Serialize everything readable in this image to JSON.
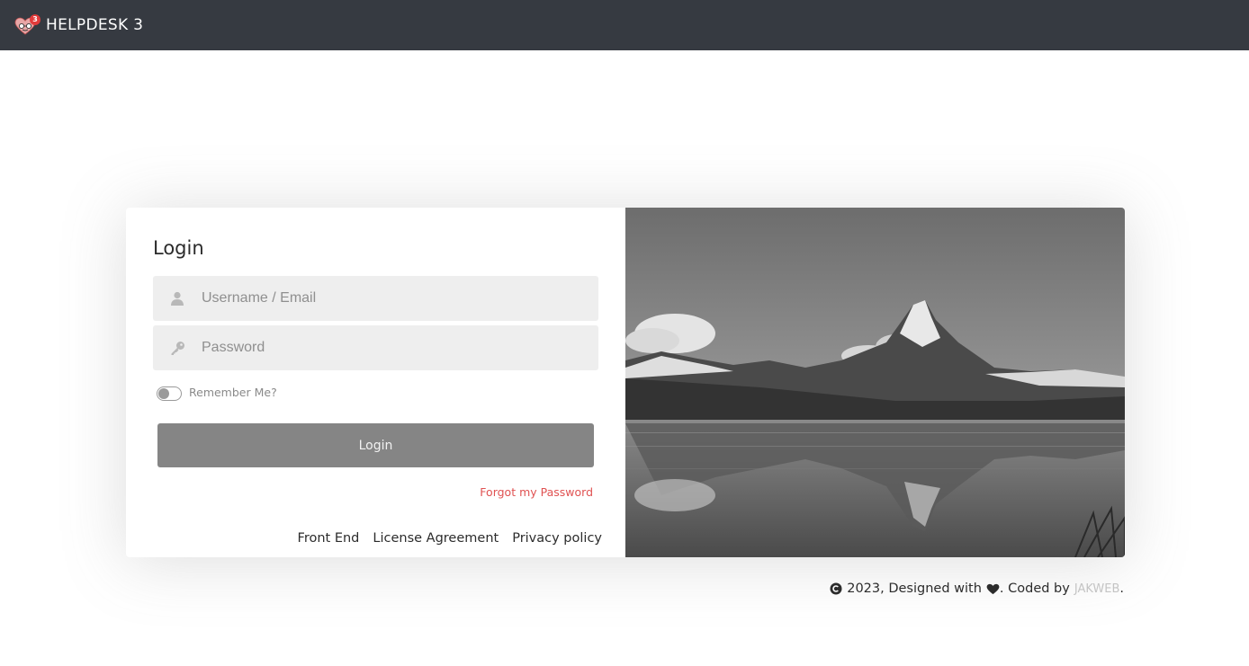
{
  "topbar": {
    "title": "HELPDESK 3",
    "logo_badge": "3",
    "logo_icon": "helpdesk-heart-logo"
  },
  "login": {
    "title": "Login",
    "username_placeholder": "Username / Email",
    "username_value": "",
    "password_placeholder": "Password",
    "password_value": "",
    "remember_label": "Remember Me?",
    "remember_checked": false,
    "submit_label": "Login",
    "forgot_label": "Forgot my Password",
    "icons": [
      "user-icon",
      "key-icon"
    ]
  },
  "footer_links": [
    "Front End",
    "License Agreement",
    "Privacy policy"
  ],
  "copyright": {
    "year_text": "2023, Designed with",
    "coded_by": ". Coded by",
    "brand": "JAKWEB",
    "end": "."
  },
  "colors": {
    "topbar": "#363a41",
    "forgot_link": "#e05252",
    "button": "#858585",
    "field_bg": "#eeeeee"
  }
}
